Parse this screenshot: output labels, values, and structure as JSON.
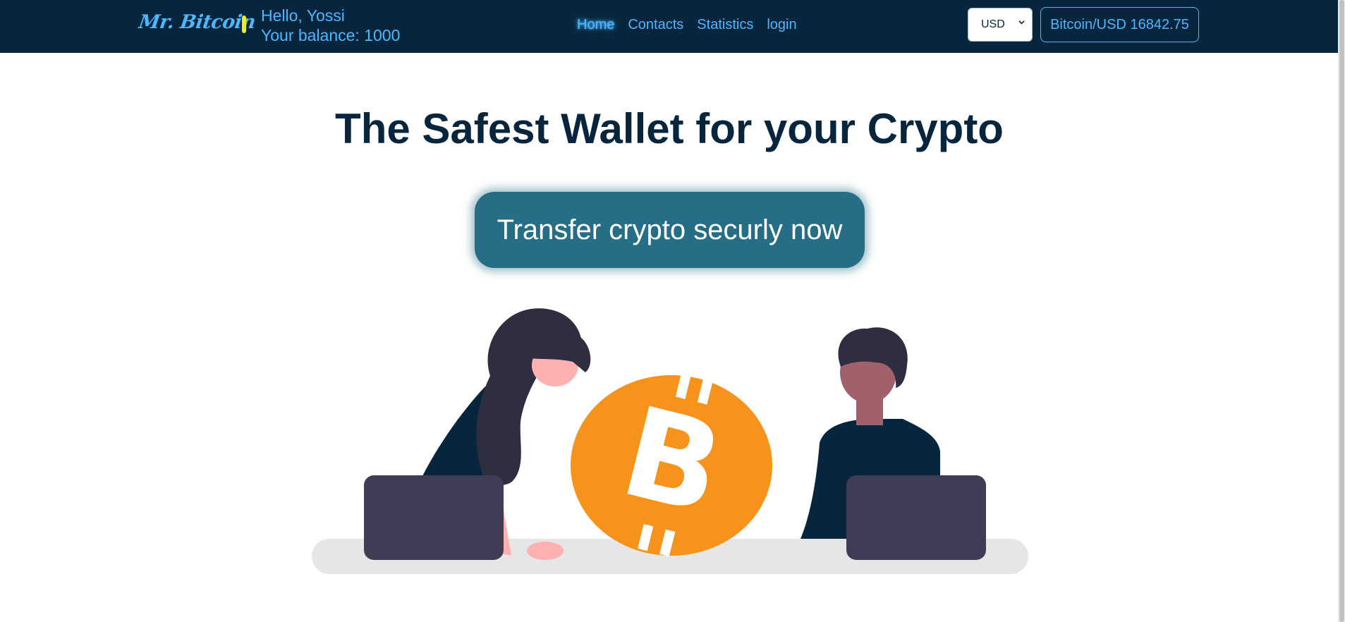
{
  "header": {
    "logo_text": "Mr. Bitcoin",
    "greeting": "Hello, Yossi",
    "balance": "Your balance: 1000",
    "nav": {
      "home": "Home",
      "contacts": "Contacts",
      "statistics": "Statistics",
      "login": "login"
    },
    "currency_selected": "USD",
    "rate": "Bitcoin/USD 16842.75"
  },
  "hero": {
    "title": "The Safest Wallet for your Crypto",
    "cta_label": "Transfer crypto securly now"
  },
  "colors": {
    "header_bg": "#07263d",
    "accent": "#4eb6ff",
    "divider": "#e8f11a",
    "cta_bg": "#266e86",
    "bitcoin": "#f7931a"
  },
  "icons": [
    "chevron-down-icon",
    "bitcoin-icon"
  ]
}
